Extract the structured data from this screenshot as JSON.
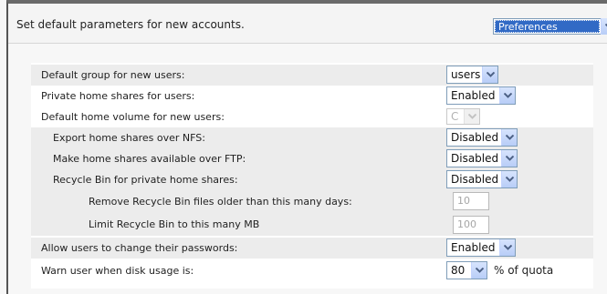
{
  "header": {
    "description": "Set default parameters for new accounts.",
    "view_select": "Preferences"
  },
  "settings": [
    {
      "label": "Default group for new users:",
      "value": "users"
    },
    {
      "label": "Private home shares for users:",
      "value": "Enabled"
    },
    {
      "label": "Default home volume for new users:",
      "value": "C"
    },
    {
      "label": "Export home shares over NFS:",
      "value": "Disabled"
    },
    {
      "label": "Make home shares available over FTP:",
      "value": "Disabled"
    },
    {
      "label": "Recycle Bin for private home shares:",
      "value": "Disabled"
    },
    {
      "label": "Remove Recycle Bin files older than this many days:",
      "value": "10"
    },
    {
      "label": "Limit Recycle Bin to this many MB",
      "value": "100"
    },
    {
      "label": "Allow users to change their passwords:",
      "value": "Enabled"
    },
    {
      "label": "Warn user when disk usage is:",
      "value": "80",
      "suffix": "% of quota"
    }
  ],
  "icons": {
    "dropdown_arrow": "chevron-down-icon"
  },
  "colors": {
    "select_border": "#7f9db9",
    "highlight": "#316ac5",
    "row_shade": "#ececec"
  }
}
